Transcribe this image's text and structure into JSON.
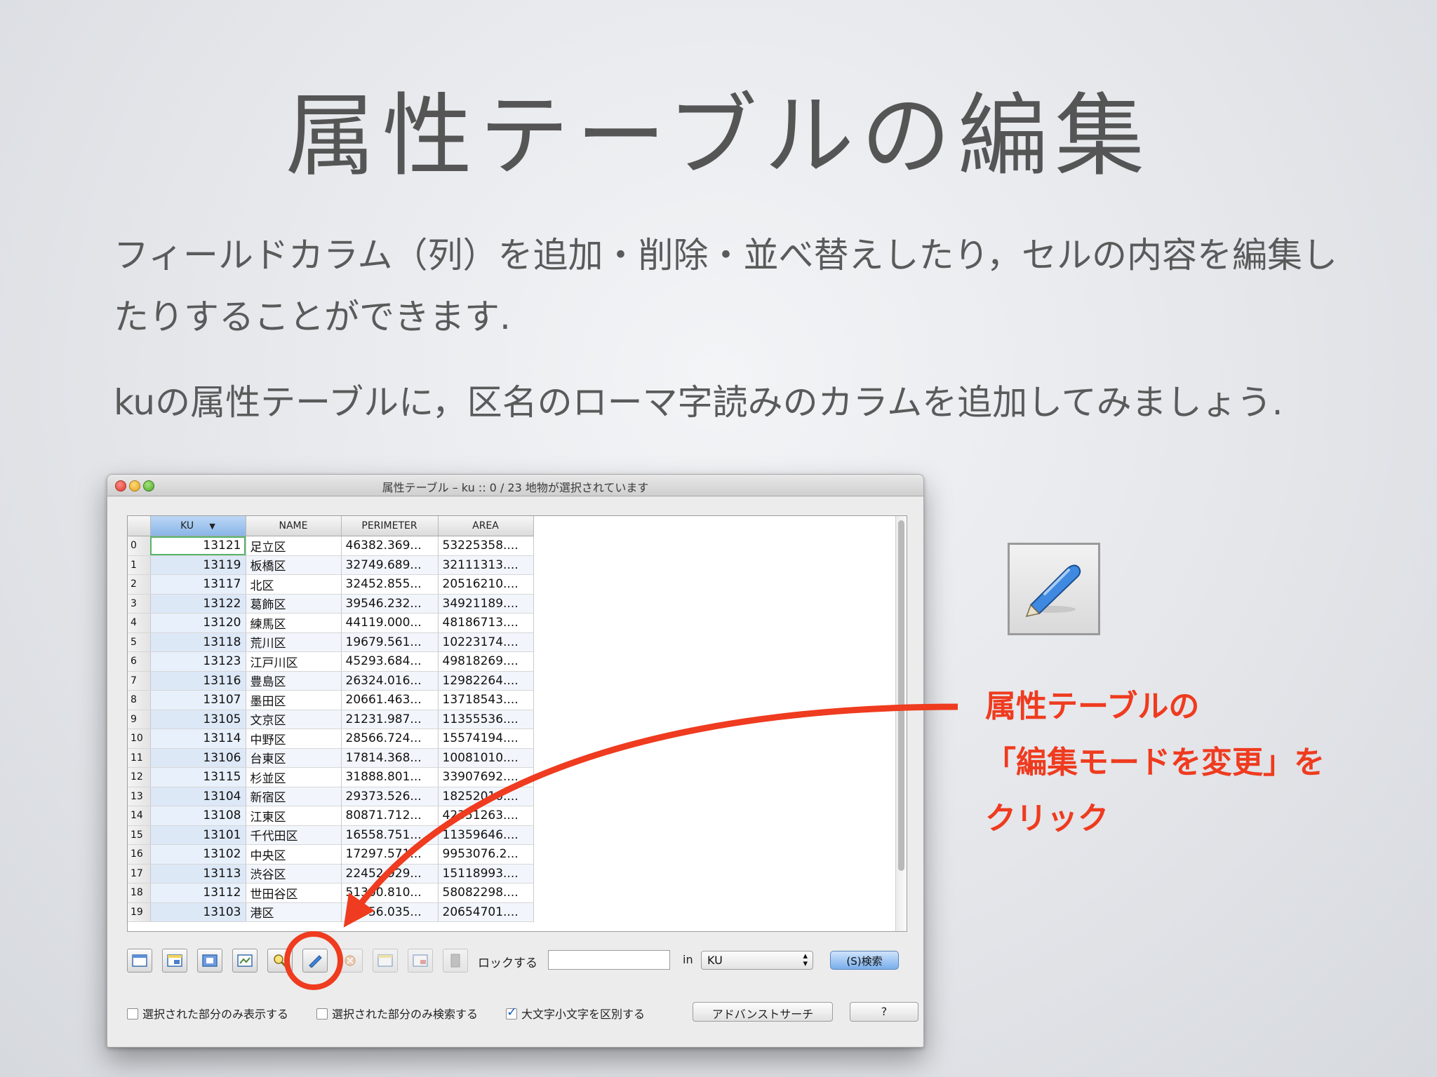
{
  "slide": {
    "title": "属性テーブルの編集",
    "para1": "フィールドカラム（列）を追加・削除・並べ替えしたり，セルの内容を編集したりすることができます.",
    "para2": "kuの属性テーブルに，区名のローマ字読みのカラムを追加してみましょう.",
    "callout_line1": "属性テーブルの",
    "callout_line2": "「編集モードを変更」を",
    "callout_line3": "クリック",
    "accent_color": "#ef3b1f"
  },
  "window": {
    "title": "属性テーブル – ku :: 0 / 23 地物が選択されています",
    "columns": [
      "KU",
      "NAME",
      "PERIMETER",
      "AREA"
    ],
    "sort_indicator": "▼",
    "rows": [
      {
        "idx": "0",
        "ku": "13121",
        "name": "足立区",
        "perimeter": "46382.369...",
        "area": "53225358...."
      },
      {
        "idx": "1",
        "ku": "13119",
        "name": "板橋区",
        "perimeter": "32749.689...",
        "area": "32111313...."
      },
      {
        "idx": "2",
        "ku": "13117",
        "name": "北区",
        "perimeter": "32452.855...",
        "area": "20516210...."
      },
      {
        "idx": "3",
        "ku": "13122",
        "name": "葛飾区",
        "perimeter": "39546.232...",
        "area": "34921189...."
      },
      {
        "idx": "4",
        "ku": "13120",
        "name": "練馬区",
        "perimeter": "44119.000...",
        "area": "48186713...."
      },
      {
        "idx": "5",
        "ku": "13118",
        "name": "荒川区",
        "perimeter": "19679.561...",
        "area": "10223174...."
      },
      {
        "idx": "6",
        "ku": "13123",
        "name": "江戸川区",
        "perimeter": "45293.684...",
        "area": "49818269...."
      },
      {
        "idx": "7",
        "ku": "13116",
        "name": "豊島区",
        "perimeter": "26324.016...",
        "area": "12982264...."
      },
      {
        "idx": "8",
        "ku": "13107",
        "name": "墨田区",
        "perimeter": "20661.463...",
        "area": "13718543...."
      },
      {
        "idx": "9",
        "ku": "13105",
        "name": "文京区",
        "perimeter": "21231.987...",
        "area": "11355536...."
      },
      {
        "idx": "10",
        "ku": "13114",
        "name": "中野区",
        "perimeter": "28566.724...",
        "area": "15574194...."
      },
      {
        "idx": "11",
        "ku": "13106",
        "name": "台東区",
        "perimeter": "17814.368...",
        "area": "10081010...."
      },
      {
        "idx": "12",
        "ku": "13115",
        "name": "杉並区",
        "perimeter": "31888.801...",
        "area": "33907692...."
      },
      {
        "idx": "13",
        "ku": "13104",
        "name": "新宿区",
        "perimeter": "29373.526...",
        "area": "18252010...."
      },
      {
        "idx": "14",
        "ku": "13108",
        "name": "江東区",
        "perimeter": "80871.712...",
        "area": "42351263...."
      },
      {
        "idx": "15",
        "ku": "13101",
        "name": "千代田区",
        "perimeter": "16558.751...",
        "area": "11359646...."
      },
      {
        "idx": "16",
        "ku": "13102",
        "name": "中央区",
        "perimeter": "17297.571...",
        "area": "9953076.2..."
      },
      {
        "idx": "17",
        "ku": "13113",
        "name": "渋谷区",
        "perimeter": "22452.929...",
        "area": "15118993...."
      },
      {
        "idx": "18",
        "ku": "13112",
        "name": "世田谷区",
        "perimeter": "51300.810...",
        "area": "58082298...."
      },
      {
        "idx": "19",
        "ku": "13103",
        "name": "港区",
        "perimeter": "34556.035...",
        "area": "20654701...."
      }
    ],
    "toolbar": {
      "lock_label": "ロックする",
      "lock_value": "",
      "in_label": "in",
      "field_select": "KU",
      "search_button": "(S)検索"
    },
    "options": {
      "show_selected_only": "選択された部分のみ表示する",
      "search_selected_only": "選択された部分のみ検索する",
      "case_sensitive": "大文字小文字を区別する",
      "advanced_search": "アドバンストサーチ",
      "help": "?"
    }
  }
}
